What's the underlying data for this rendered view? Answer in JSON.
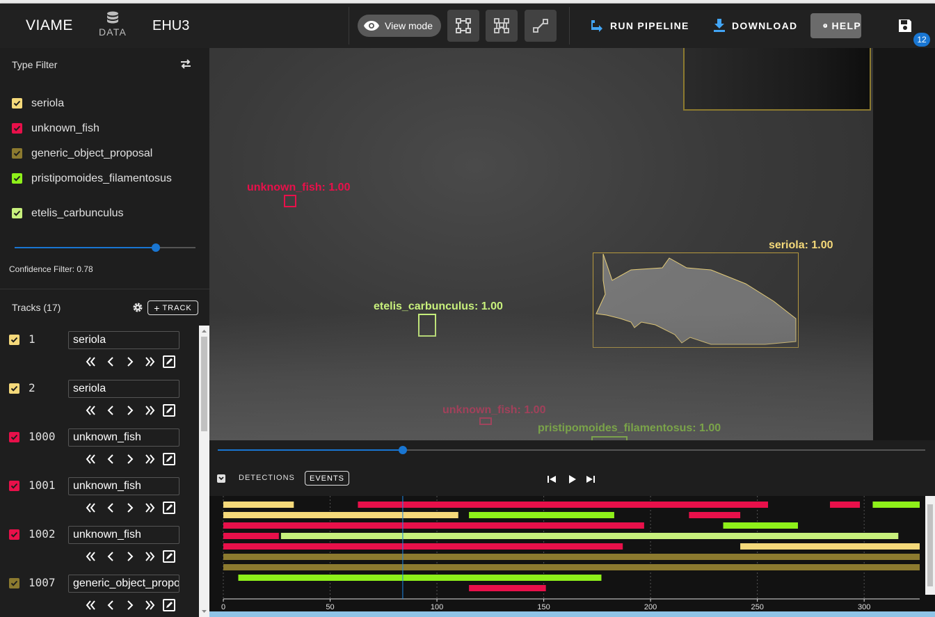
{
  "app": {
    "brand": "VIAME",
    "data_tab_label": "DATA",
    "dataset_name": "EHU3"
  },
  "toolbar": {
    "view_mode_label": "View mode",
    "run_pipeline_label": "RUN PIPELINE",
    "download_label": "DOWNLOAD",
    "help_label": "HELP",
    "pending_save_count": "12"
  },
  "colors": {
    "seriola": "#f5d97a",
    "unknown_fish": "#e8104a",
    "generic_object_proposal": "#8c7a2f",
    "pristipomoides_filamentosus": "#8ef01a",
    "etelis_carbunculus": "#c8f07c",
    "accent": "#1976d2"
  },
  "type_filter": {
    "title": "Type Filter",
    "types": [
      {
        "label": "seriola",
        "color": "#f5d97a"
      },
      {
        "label": "unknown_fish",
        "color": "#e8104a"
      },
      {
        "label": "generic_object_proposal",
        "color": "#8c7a2f"
      },
      {
        "label": "pristipomoides_filamentosus",
        "color": "#8ef01a"
      },
      {
        "label": "etelis_carbunculus",
        "color": "#c8f07c"
      }
    ],
    "confidence_value": 0.78,
    "confidence_label": "Confidence Filter: 0.78"
  },
  "tracks": {
    "title": "Tracks (17)",
    "add_label": "TRACK",
    "items": [
      {
        "id": "1",
        "type": "seriola",
        "color": "#f5d97a"
      },
      {
        "id": "2",
        "type": "seriola",
        "color": "#f5d97a"
      },
      {
        "id": "1000",
        "type": "unknown_fish",
        "color": "#e8104a"
      },
      {
        "id": "1001",
        "type": "unknown_fish",
        "color": "#e8104a"
      },
      {
        "id": "1002",
        "type": "unknown_fish",
        "color": "#e8104a"
      },
      {
        "id": "1007",
        "type": "generic_object_proposal",
        "color": "#8c7a2f"
      }
    ]
  },
  "annotations": [
    {
      "label": "unknown_fish: 1.00",
      "color": "#e8104a"
    },
    {
      "label": "seriola: 1.00",
      "color": "#f5d97a"
    },
    {
      "label": "etelis_carbunculus: 1.00",
      "color": "#c8f07c"
    },
    {
      "label": "unknown_fish: 1.00",
      "color": "#e8104a"
    },
    {
      "label": "pristipomoides_filamentosus: 1.00",
      "color": "#8ef01a"
    }
  ],
  "timeline": {
    "detections_tab": "DETECTIONS",
    "events_tab": "EVENTS",
    "frame_position": 0.262,
    "current_frame": 84,
    "frame_max": 326,
    "ticks": [
      0,
      50,
      100,
      150,
      200,
      250,
      300
    ],
    "events": [
      {
        "start": 0,
        "end": 33,
        "color": "#f5d97a",
        "row": 0
      },
      {
        "start": 63,
        "end": 255,
        "color": "#e8104a",
        "row": 0
      },
      {
        "start": 284,
        "end": 298,
        "color": "#e8104a",
        "row": 0
      },
      {
        "start": 304,
        "end": 326,
        "color": "#8ef01a",
        "row": 0
      },
      {
        "start": 0,
        "end": 110,
        "color": "#f5d97a",
        "row": 1
      },
      {
        "start": 115,
        "end": 183,
        "color": "#8ef01a",
        "row": 1
      },
      {
        "start": 218,
        "end": 242,
        "color": "#e8104a",
        "row": 1
      },
      {
        "start": 0,
        "end": 197,
        "color": "#e8104a",
        "row": 2
      },
      {
        "start": 234,
        "end": 269,
        "color": "#8ef01a",
        "row": 2
      },
      {
        "start": 0,
        "end": 26,
        "color": "#e8104a",
        "row": 3
      },
      {
        "start": 27,
        "end": 316,
        "color": "#c8f07c",
        "row": 3
      },
      {
        "start": 0,
        "end": 187,
        "color": "#e8104a",
        "row": 4
      },
      {
        "start": 242,
        "end": 326,
        "color": "#f5d97a",
        "row": 4
      },
      {
        "start": 0,
        "end": 326,
        "color": "#8c7a2f",
        "row": 5
      },
      {
        "start": 0,
        "end": 326,
        "color": "#8c7a2f",
        "row": 6
      },
      {
        "start": 7,
        "end": 177,
        "color": "#8ef01a",
        "row": 7
      },
      {
        "start": 115,
        "end": 151,
        "color": "#e8104a",
        "row": 8
      }
    ]
  }
}
